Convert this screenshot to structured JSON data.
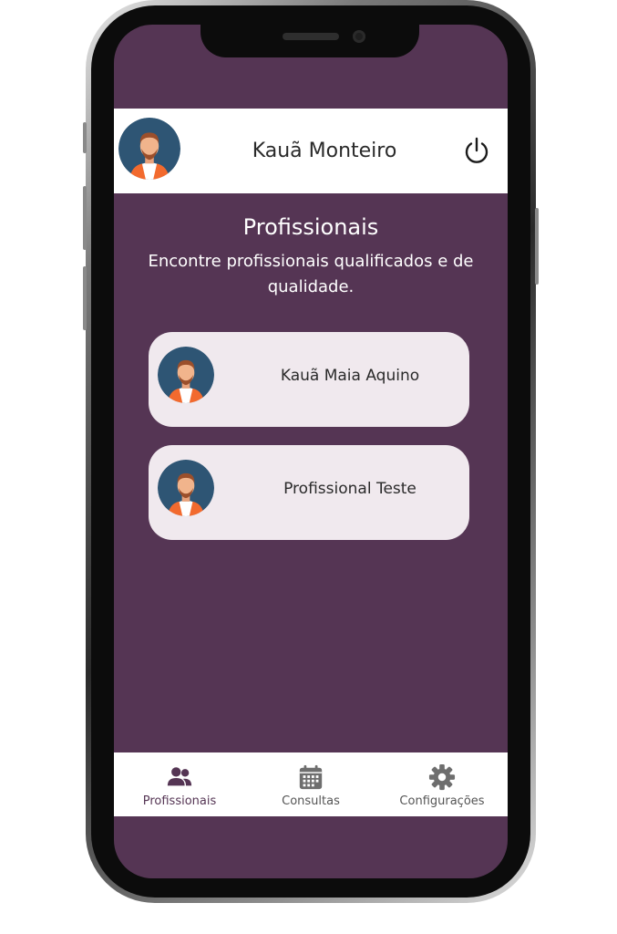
{
  "colors": {
    "screen_bg": "#553554",
    "accent": "#553554",
    "card_bg": "#f0e9ee",
    "avatar_bg": "#2e5574",
    "inactive_icon": "#6e6e6e"
  },
  "header": {
    "user_name": "Kauã Monteiro",
    "avatar_icon": "user-avatar-icon",
    "logout_icon": "power-icon"
  },
  "main": {
    "title": "Profissionais",
    "subtitle": "Encontre profissionais qualificados e de qualidade."
  },
  "professionals": [
    {
      "name": "Kauã Maia Aquino"
    },
    {
      "name": "Profissional Teste"
    }
  ],
  "bottom_nav": {
    "items": [
      {
        "label": "Profissionais",
        "icon": "users-icon",
        "active": true
      },
      {
        "label": "Consultas",
        "icon": "calendar-icon",
        "active": false
      },
      {
        "label": "Configurações",
        "icon": "gear-icon",
        "active": false
      }
    ]
  }
}
